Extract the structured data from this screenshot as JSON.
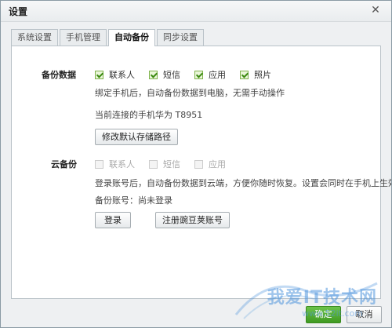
{
  "window": {
    "title": "设置"
  },
  "tabs": [
    {
      "label": "系统设置",
      "active": false
    },
    {
      "label": "手机管理",
      "active": false
    },
    {
      "label": "自动备份",
      "active": true
    },
    {
      "label": "同步设置",
      "active": false
    }
  ],
  "backup_data": {
    "label": "备份数据",
    "options": [
      {
        "label": "联系人",
        "checked": true
      },
      {
        "label": "短信",
        "checked": true
      },
      {
        "label": "应用",
        "checked": true
      },
      {
        "label": "照片",
        "checked": true
      }
    ],
    "description": "绑定手机后，自动备份数据到电脑，无需手动操作",
    "current_phone": "当前连接的手机华为 T8951",
    "change_path_button": "修改默认存储路径"
  },
  "cloud_backup": {
    "label": "云备份",
    "options": [
      {
        "label": "联系人",
        "checked": false,
        "disabled": true
      },
      {
        "label": "短信",
        "checked": false,
        "disabled": true
      },
      {
        "label": "应用",
        "checked": false,
        "disabled": true
      }
    ],
    "description": "登录账号后，自动备份数据到云端，方便你随时恢复。设置会同时在手机上生效。",
    "account_status": "备份账号：尚未登录",
    "login_button": "登录",
    "register_button": "注册豌豆荚账号"
  },
  "footer": {
    "ok_button": "确定",
    "cancel_button": "取消"
  },
  "watermark": {
    "text": "我爱IT技术网",
    "sub": "www.52it.com"
  },
  "colors": {
    "checkbox_border": "#7fb24c",
    "checkmark": "#3c8a12",
    "primary_button": "#3f9a22",
    "watermark": "#5096dc"
  }
}
